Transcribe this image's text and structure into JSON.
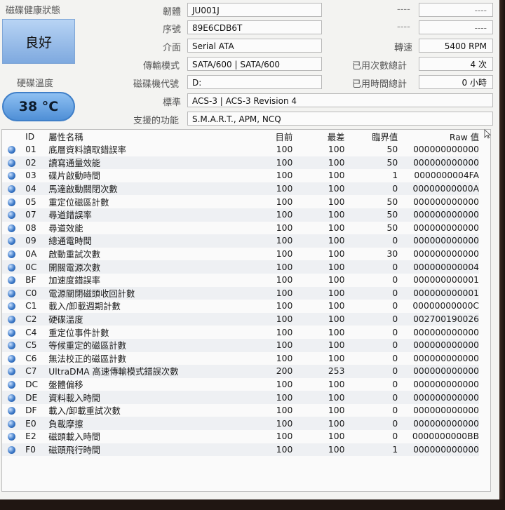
{
  "health": {
    "title": "磁碟健康狀態",
    "status": "良好",
    "temp_title": "硬碟溫度",
    "temperature": "38 °C"
  },
  "info": {
    "firmware_label": "韌體",
    "firmware": "JU001J",
    "serial_label": "序號",
    "serial": "89E6CDB6T",
    "interface_label": "介面",
    "interface": "Serial ATA",
    "transfer_label": "傳輸模式",
    "transfer": "SATA/600 | SATA/600",
    "drive_label": "磁碟機代號",
    "drive": "D:",
    "standard_label": "標準",
    "standard": "ACS-3 | ACS-3 Revision 4",
    "features_label": "支援的功能",
    "features": "S.M.A.R.T., APM, NCQ",
    "right_top1_label": "----",
    "right_top1_value": "----",
    "right_top2_label": "----",
    "right_top2_value": "----",
    "rpm_label": "轉速",
    "rpm": "5400 RPM",
    "power_count_label": "已用次數總計",
    "power_count": "4 次",
    "power_hours_label": "已用時間總計",
    "power_hours": "0 小時"
  },
  "smart": {
    "headers": {
      "id": "ID",
      "name": "屬性名稱",
      "current": "目前",
      "worst": "最差",
      "threshold": "臨界值",
      "raw": "Raw 值"
    },
    "rows": [
      {
        "id": "01",
        "name": "底層資料讀取錯誤率",
        "current": "100",
        "worst": "100",
        "threshold": "50",
        "raw": "000000000000"
      },
      {
        "id": "02",
        "name": "讀寫通量效能",
        "current": "100",
        "worst": "100",
        "threshold": "50",
        "raw": "000000000000"
      },
      {
        "id": "03",
        "name": "碟片啟動時間",
        "current": "100",
        "worst": "100",
        "threshold": "1",
        "raw": "0000000004FA"
      },
      {
        "id": "04",
        "name": "馬達啟動關閉次數",
        "current": "100",
        "worst": "100",
        "threshold": "0",
        "raw": "00000000000A"
      },
      {
        "id": "05",
        "name": "重定位磁區計數",
        "current": "100",
        "worst": "100",
        "threshold": "50",
        "raw": "000000000000"
      },
      {
        "id": "07",
        "name": "尋道錯誤率",
        "current": "100",
        "worst": "100",
        "threshold": "50",
        "raw": "000000000000"
      },
      {
        "id": "08",
        "name": "尋道效能",
        "current": "100",
        "worst": "100",
        "threshold": "50",
        "raw": "000000000000"
      },
      {
        "id": "09",
        "name": "總通電時間",
        "current": "100",
        "worst": "100",
        "threshold": "0",
        "raw": "000000000000"
      },
      {
        "id": "0A",
        "name": "啟動重試次數",
        "current": "100",
        "worst": "100",
        "threshold": "30",
        "raw": "000000000000"
      },
      {
        "id": "0C",
        "name": "開關電源次數",
        "current": "100",
        "worst": "100",
        "threshold": "0",
        "raw": "000000000004"
      },
      {
        "id": "BF",
        "name": "加速度錯誤率",
        "current": "100",
        "worst": "100",
        "threshold": "0",
        "raw": "000000000001"
      },
      {
        "id": "C0",
        "name": "電源關閉磁頭收回計數",
        "current": "100",
        "worst": "100",
        "threshold": "0",
        "raw": "000000000001"
      },
      {
        "id": "C1",
        "name": "載入/卸載週期計數",
        "current": "100",
        "worst": "100",
        "threshold": "0",
        "raw": "00000000000C"
      },
      {
        "id": "C2",
        "name": "硬碟溫度",
        "current": "100",
        "worst": "100",
        "threshold": "0",
        "raw": "002700190026"
      },
      {
        "id": "C4",
        "name": "重定位事件計數",
        "current": "100",
        "worst": "100",
        "threshold": "0",
        "raw": "000000000000"
      },
      {
        "id": "C5",
        "name": "等候重定的磁區計數",
        "current": "100",
        "worst": "100",
        "threshold": "0",
        "raw": "000000000000"
      },
      {
        "id": "C6",
        "name": "無法校正的磁區計數",
        "current": "100",
        "worst": "100",
        "threshold": "0",
        "raw": "000000000000"
      },
      {
        "id": "C7",
        "name": "UltraDMA 高速傳輸模式錯誤次數",
        "current": "200",
        "worst": "253",
        "threshold": "0",
        "raw": "000000000000"
      },
      {
        "id": "DC",
        "name": "盤體偏移",
        "current": "100",
        "worst": "100",
        "threshold": "0",
        "raw": "000000000000"
      },
      {
        "id": "DE",
        "name": "資料載入時間",
        "current": "100",
        "worst": "100",
        "threshold": "0",
        "raw": "000000000000"
      },
      {
        "id": "DF",
        "name": "載入/卸載重試次數",
        "current": "100",
        "worst": "100",
        "threshold": "0",
        "raw": "000000000000"
      },
      {
        "id": "E0",
        "name": "負載摩擦",
        "current": "100",
        "worst": "100",
        "threshold": "0",
        "raw": "000000000000"
      },
      {
        "id": "E2",
        "name": "磁頭載入時間",
        "current": "100",
        "worst": "100",
        "threshold": "0",
        "raw": "0000000000BB"
      },
      {
        "id": "F0",
        "name": "磁頭飛行時間",
        "current": "100",
        "worst": "100",
        "threshold": "1",
        "raw": "000000000000"
      }
    ]
  }
}
